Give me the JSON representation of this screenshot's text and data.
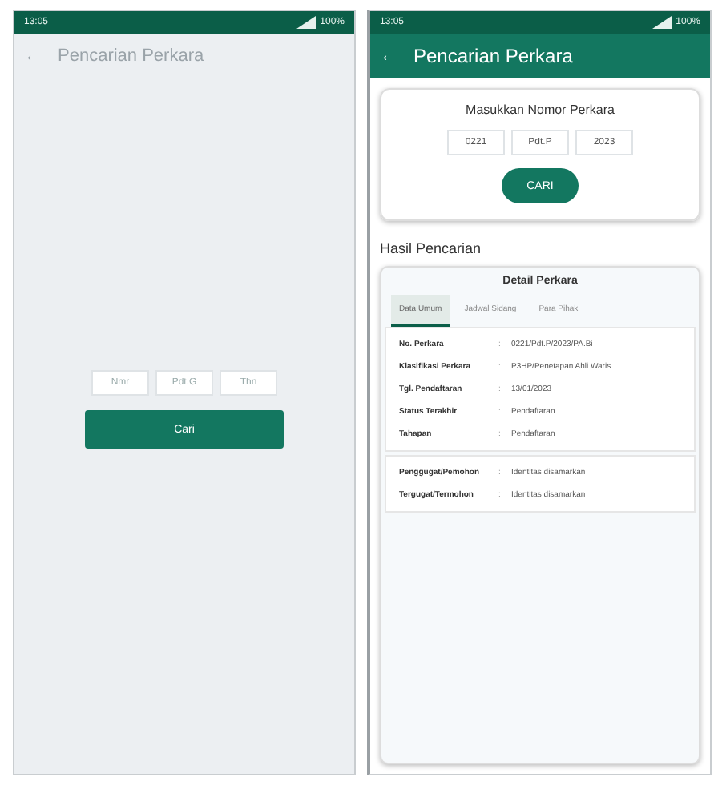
{
  "screens": [
    {
      "status_bar": {
        "time": "13:05",
        "battery": "100%"
      },
      "app_bar": {
        "back": "←",
        "title": "Pencarian Perkara",
        "active": false
      },
      "search": {
        "kind": "plain",
        "fields": [
          {
            "placeholder": "Nmr"
          },
          {
            "placeholder": "Pdt.G"
          },
          {
            "placeholder": "Thn"
          }
        ],
        "button": "Cari"
      }
    },
    {
      "status_bar": {
        "time": "13:05",
        "battery": "100%"
      },
      "app_bar": {
        "back": "←",
        "title": "Pencarian Perkara",
        "active": true
      },
      "search": {
        "kind": "card",
        "heading": "Masukkan Nomor Perkara",
        "fields": [
          {
            "value": "0221"
          },
          {
            "value": "Pdt.P"
          },
          {
            "value": "2023"
          }
        ],
        "button": "CARI"
      },
      "results": {
        "title": "Hasil Pencarian",
        "card_title": "Detail Perkara",
        "tabs": [
          {
            "label": "Data Umum",
            "selected": true
          },
          {
            "label": "Jadwal Sidang",
            "selected": false
          },
          {
            "label": "Para Pihak",
            "selected": false
          }
        ],
        "groups": [
          [
            {
              "label": "No. Perkara",
              "sep": ":",
              "value": "0221/Pdt.P/2023/PA.Bi"
            },
            {
              "label": "Klasifikasi Perkara",
              "sep": ":",
              "value": "P3HP/Penetapan Ahli Waris"
            },
            {
              "label": "Tgl. Pendaftaran",
              "sep": ":",
              "value": "13/01/2023"
            },
            {
              "label": "Status Terakhir",
              "sep": ":",
              "value": "Pendaftaran"
            },
            {
              "label": "Tahapan",
              "sep": ":",
              "value": "Pendaftaran"
            }
          ],
          [
            {
              "label": "Penggugat/Pemohon",
              "sep": ":",
              "value": "Identitas disamarkan"
            },
            {
              "label": "Tergugat/Termohon",
              "sep": ":",
              "value": "Identitas disamarkan"
            }
          ]
        ]
      }
    }
  ]
}
